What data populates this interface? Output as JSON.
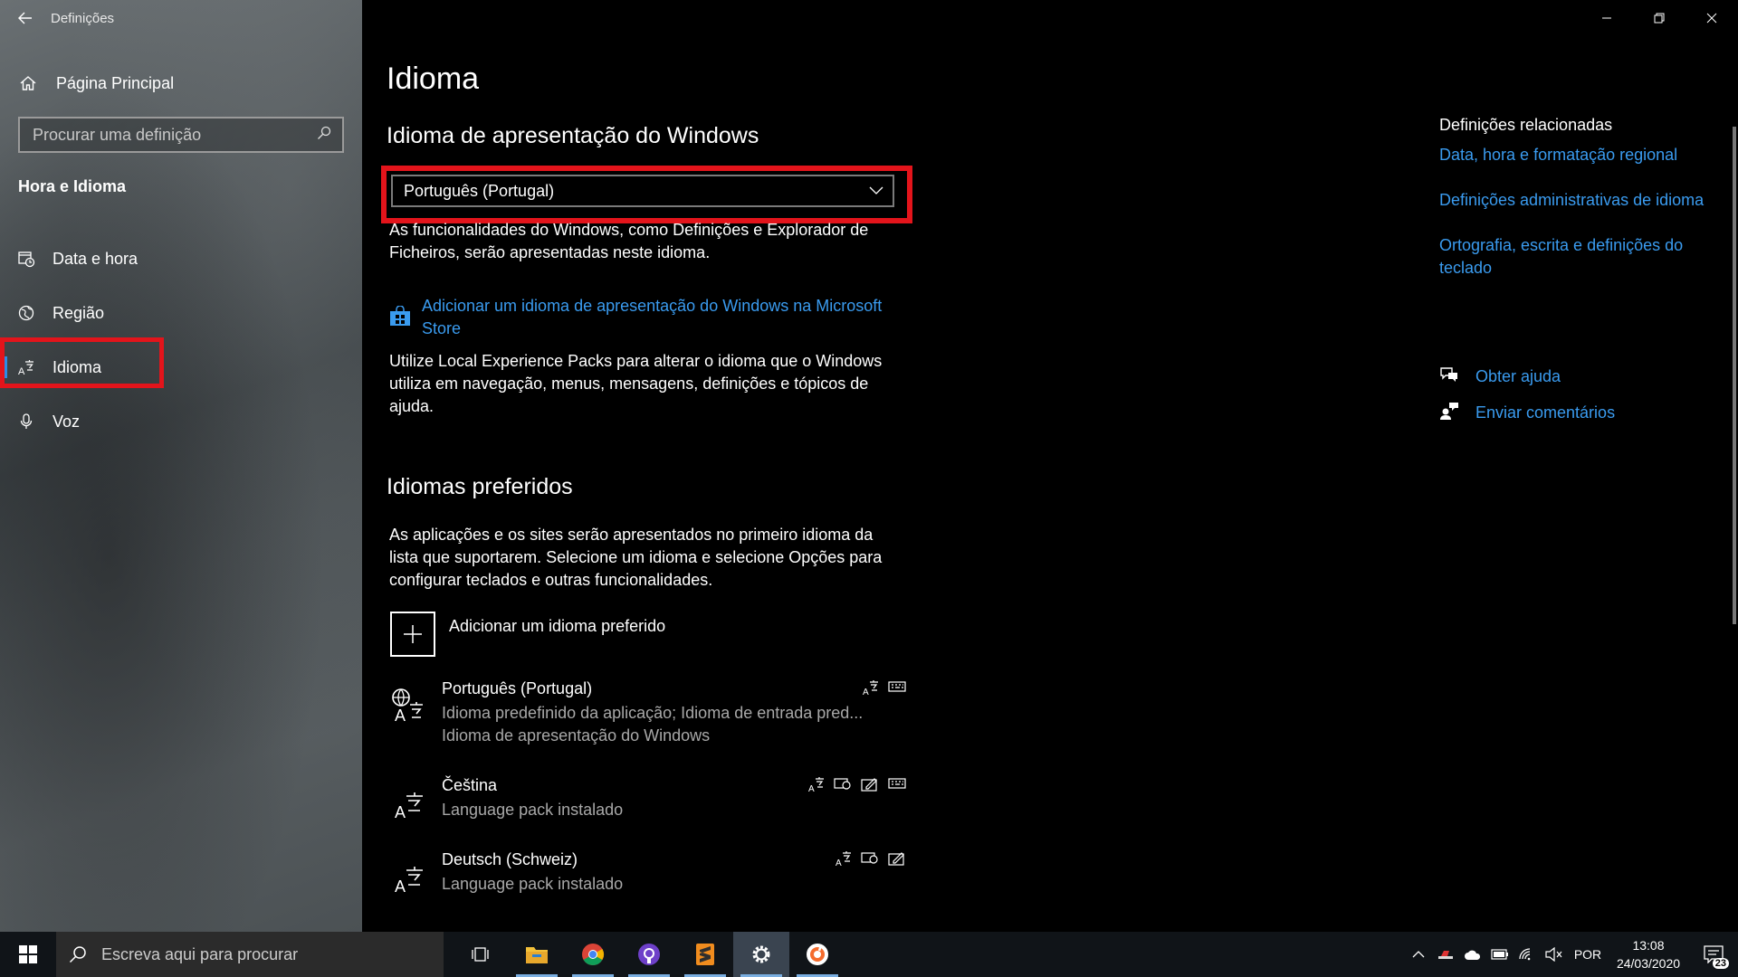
{
  "window": {
    "title": "Definições"
  },
  "sidebar": {
    "home_label": "Página Principal",
    "search_placeholder": "Procurar uma definição",
    "section_title": "Hora e Idioma",
    "items": [
      {
        "label": "Data e hora",
        "icon": "calendar-clock-icon"
      },
      {
        "label": "Região",
        "icon": "globe-region-icon"
      },
      {
        "label": "Idioma",
        "icon": "language-icon",
        "active": true
      },
      {
        "label": "Voz",
        "icon": "microphone-icon"
      }
    ]
  },
  "main": {
    "title": "Idioma",
    "display_section": {
      "heading": "Idioma de apresentação do Windows",
      "selected": "Português (Portugal)",
      "description": "As funcionalidades do Windows, como Definições e Explorador de Ficheiros, serão apresentadas neste idioma.",
      "store_link": "Adicionar um idioma de apresentação do Windows na Microsoft Store",
      "lxp_text": "Utilize Local Experience Packs para alterar o idioma que o Windows utiliza em navegação, menus, mensagens, definições e tópicos de ajuda."
    },
    "preferred_section": {
      "heading": "Idiomas preferidos",
      "description": "As aplicações e os sites serão apresentados no primeiro idioma da lista que suportarem. Selecione um idioma e selecione Opções para configurar teclados e outras funcionalidades.",
      "add_label": "Adicionar um idioma preferido",
      "languages": [
        {
          "name": "Português (Portugal)",
          "sub1": "Idioma predefinido da aplicação; Idioma de entrada pred...",
          "sub2": "Idioma de apresentação do Windows"
        },
        {
          "name": "Čeština",
          "sub1": "Language pack instalado"
        },
        {
          "name": "Deutsch (Schweiz)",
          "sub1": "Language pack instalado"
        }
      ]
    }
  },
  "related": {
    "title": "Definições relacionadas",
    "links": [
      "Data, hora e formatação regional",
      "Definições administrativas de idioma",
      "Ortografia, escrita e definições do teclado"
    ],
    "help": "Obter ajuda",
    "feedback": "Enviar comentários"
  },
  "taskbar": {
    "search_placeholder": "Escreva aqui para procurar",
    "apps": [
      "task-view",
      "file-explorer",
      "chrome",
      "github-desktop",
      "sublime-text",
      "settings",
      "origin"
    ],
    "lang": "POR",
    "time": "13:08",
    "date": "24/03/2020",
    "notifications": "23"
  },
  "colors": {
    "accent": "#3a9bef",
    "highlight": "#e3141b"
  }
}
